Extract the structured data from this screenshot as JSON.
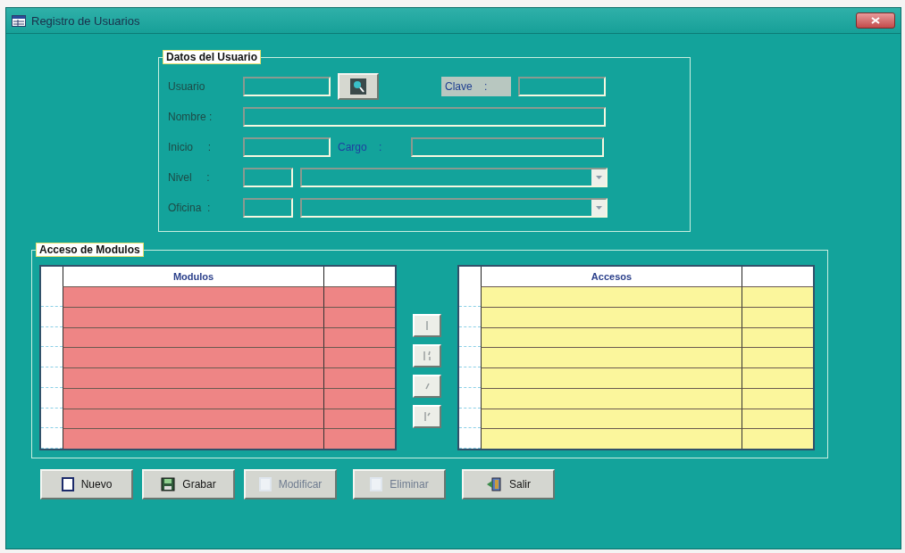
{
  "window": {
    "title": "Registro de Usuarios"
  },
  "user_group": {
    "title": "Datos del Usuario",
    "rows": [
      {
        "fields": [
          {
            "kind": "label",
            "text": "Usuario",
            "disabled": true
          },
          {
            "kind": "input"
          },
          {
            "kind": "search"
          },
          {
            "kind": "label",
            "text": "Clave    :",
            "disabled": false
          },
          {
            "kind": "input"
          }
        ]
      },
      {
        "fields": [
          {
            "kind": "label",
            "text": "Nombre :",
            "disabled": true
          },
          {
            "kind": "input"
          }
        ]
      },
      {
        "fields": [
          {
            "kind": "label",
            "text": "Inicio     :",
            "disabled": true
          },
          {
            "kind": "input"
          },
          {
            "kind": "label",
            "text": "Cargo    :",
            "disabled": false
          },
          {
            "kind": "input"
          }
        ]
      },
      {
        "fields": [
          {
            "kind": "label",
            "text": "Nivel     :",
            "disabled": true
          },
          {
            "kind": "input"
          },
          {
            "kind": "combo"
          }
        ]
      },
      {
        "fields": [
          {
            "kind": "label",
            "text": "Oficina  :",
            "disabled": true
          },
          {
            "kind": "input"
          },
          {
            "kind": "combo"
          }
        ]
      }
    ]
  },
  "access_group": {
    "title": "Acceso de Modulos",
    "grids": [
      {
        "column": "Modulos",
        "color": "#ee8585"
      },
      {
        "column": "Accesos",
        "color": "#fbf69c"
      }
    ],
    "move_buttons": [
      {
        "kind": "single"
      },
      {
        "kind": "double"
      },
      {
        "kind": "back"
      },
      {
        "kind": "all"
      }
    ]
  },
  "buttons": [
    {
      "label": "Nuevo",
      "disabled": false
    },
    {
      "label": "Grabar",
      "disabled": false
    },
    {
      "label": "Modificar",
      "disabled": true
    },
    {
      "label": "Eliminar",
      "disabled": true
    },
    {
      "label": "Salir",
      "disabled": false
    }
  ]
}
